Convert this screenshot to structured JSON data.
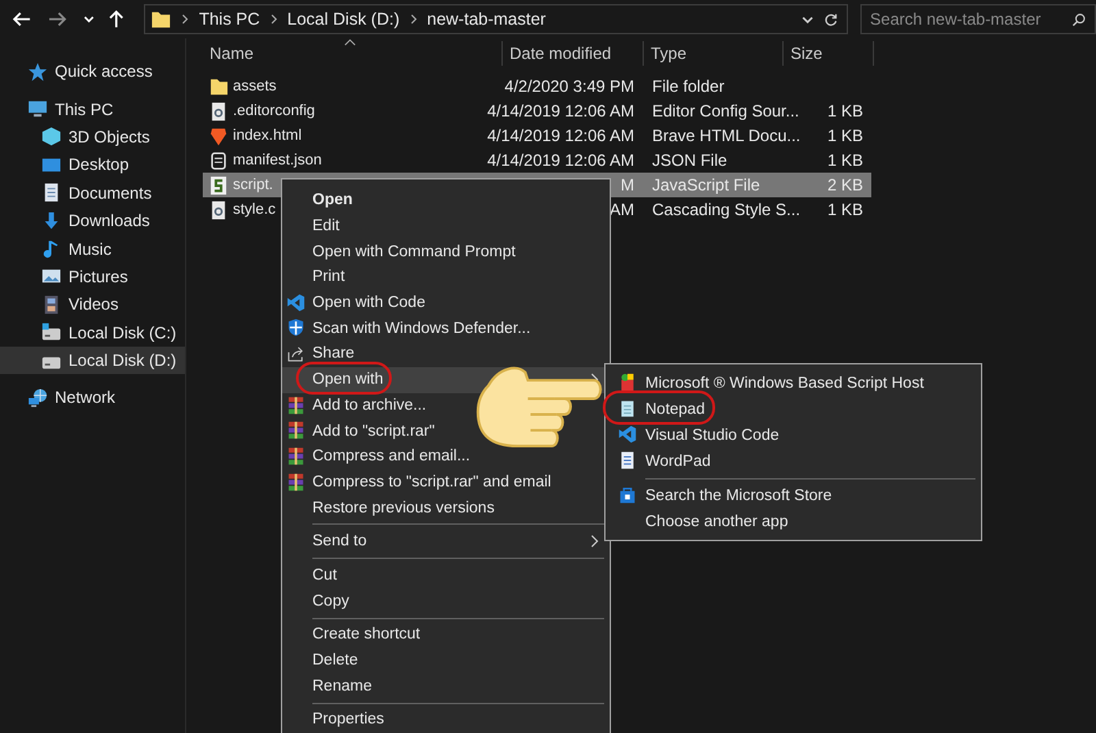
{
  "address_bar": {
    "path": [
      "This PC",
      "Local Disk (D:)",
      "new-tab-master"
    ]
  },
  "search": {
    "placeholder": "Search new-tab-master"
  },
  "sidebar": {
    "items": [
      {
        "label": "Quick access",
        "kind": "star",
        "selected": false
      },
      {
        "label": "This PC",
        "kind": "pc",
        "selected": false,
        "children": [
          {
            "label": "3D Objects",
            "kind": "cube",
            "selected": false
          },
          {
            "label": "Desktop",
            "kind": "desktop",
            "selected": false
          },
          {
            "label": "Documents",
            "kind": "documents",
            "selected": false
          },
          {
            "label": "Downloads",
            "kind": "downloads",
            "selected": false
          },
          {
            "label": "Music",
            "kind": "music",
            "selected": false
          },
          {
            "label": "Pictures",
            "kind": "pictures",
            "selected": false
          },
          {
            "label": "Videos",
            "kind": "videos",
            "selected": false
          },
          {
            "label": "Local Disk (C:)",
            "kind": "drive-win",
            "selected": false
          },
          {
            "label": "Local Disk (D:)",
            "kind": "drive",
            "selected": true
          }
        ]
      },
      {
        "label": "Network",
        "kind": "network",
        "selected": false
      }
    ]
  },
  "table": {
    "columns": [
      "Name",
      "Date modified",
      "Type",
      "Size"
    ],
    "rows": [
      {
        "kind": "folder",
        "name": "assets",
        "date": "4/2/2020 3:49 PM",
        "type": "File folder",
        "selected": false
      },
      {
        "kind": "config",
        "name": ".editorconfig",
        "date": "4/14/2019 12:06 AM",
        "type": "Editor Config Sour...",
        "size": "1 KB",
        "selected": false
      },
      {
        "kind": "html",
        "name": "index.html",
        "date": "4/14/2019 12:06 AM",
        "type": "Brave HTML Docu...",
        "size": "1 KB",
        "selected": false
      },
      {
        "kind": "json",
        "name": "manifest.json",
        "date": "4/14/2019 12:06 AM",
        "type": "JSON File",
        "size": "1 KB",
        "selected": false
      },
      {
        "kind": "js",
        "name": "script.",
        "date": "M",
        "type": "JavaScript File",
        "size": "2 KB",
        "selected": true
      },
      {
        "kind": "css",
        "name": "style.c",
        "date": "AM",
        "type": "Cascading Style S...",
        "size": "1 KB",
        "selected": false
      }
    ]
  },
  "context_menu": {
    "items": [
      {
        "kind": "plain",
        "label": "Open",
        "default": true,
        "selected": false
      },
      {
        "kind": "plain",
        "label": "Edit",
        "selected": false
      },
      {
        "kind": "plain",
        "label": "Open with Command Prompt",
        "selected": false
      },
      {
        "kind": "plain",
        "label": "Print",
        "selected": false
      },
      {
        "kind": "vscode",
        "label": "Open with Code",
        "selected": false
      },
      {
        "kind": "defender",
        "label": "Scan with Windows Defender...",
        "selected": false
      },
      {
        "kind": "share",
        "label": "Share",
        "selected": false
      },
      {
        "kind": "plain",
        "label": "Open with",
        "submenu": true,
        "selected": true
      },
      {
        "kind": "archive",
        "label": "Add to archive...",
        "selected": false
      },
      {
        "kind": "archive",
        "label": "Add to \"script.rar\"",
        "selected": false
      },
      {
        "kind": "archive",
        "label": "Compress and email...",
        "selected": false
      },
      {
        "kind": "archive",
        "label": "Compress to \"script.rar\" and email",
        "selected": false
      },
      {
        "kind": "plain",
        "label": "Restore previous versions",
        "selected": false
      },
      {
        "kind": "separator"
      },
      {
        "kind": "plain",
        "label": "Send to",
        "submenu": true,
        "selected": false
      },
      {
        "kind": "separator"
      },
      {
        "kind": "plain",
        "label": "Cut",
        "selected": false
      },
      {
        "kind": "plain",
        "label": "Copy",
        "selected": false
      },
      {
        "kind": "separator"
      },
      {
        "kind": "plain",
        "label": "Create shortcut",
        "selected": false
      },
      {
        "kind": "plain",
        "label": "Delete",
        "selected": false
      },
      {
        "kind": "plain",
        "label": "Rename",
        "selected": false
      },
      {
        "kind": "separator"
      },
      {
        "kind": "plain",
        "label": "Properties",
        "selected": false
      }
    ]
  },
  "open_with_menu": {
    "items": [
      {
        "kind": "scripthost",
        "label": "Microsoft ® Windows Based Script Host",
        "selected": false
      },
      {
        "kind": "notepad",
        "label": "Notepad",
        "selected": false
      },
      {
        "kind": "vscode",
        "label": "Visual Studio Code",
        "selected": false
      },
      {
        "kind": "wordpad",
        "label": "WordPad",
        "selected": false
      },
      {
        "kind": "separator"
      },
      {
        "kind": "store",
        "label": "Search the Microsoft Store",
        "selected": false
      },
      {
        "kind": "plain",
        "label": "Choose another app",
        "selected": false
      }
    ]
  }
}
